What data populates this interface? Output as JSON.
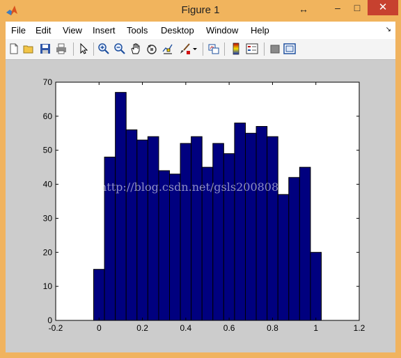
{
  "window": {
    "title": "Figure 1",
    "controls": {
      "resize": "↔",
      "minimize": "–",
      "maximize": "□",
      "close": "✕"
    }
  },
  "menu": {
    "items": [
      "File",
      "Edit",
      "View",
      "Insert",
      "Tools",
      "Desktop",
      "Window",
      "Help"
    ],
    "dock_arrow": "↘"
  },
  "toolbar": {
    "buttons": [
      "new-figure-icon",
      "open-file-icon",
      "save-icon",
      "print-icon",
      "edit-plot-arrow-icon",
      "zoom-in-icon",
      "zoom-out-icon",
      "pan-hand-icon",
      "rotate-3d-icon",
      "data-cursor-icon",
      "brush-icon",
      "brush-dropdown-icon",
      "link-plot-icon",
      "colorbar-icon",
      "legend-icon",
      "hide-plot-tools-icon",
      "show-plot-tools-icon"
    ]
  },
  "watermark": "http://blog.csdn.net/gsls200808",
  "colors": {
    "bar_fill": "#00007f",
    "bar_edge": "#000000",
    "figure_bg": "#cccccc",
    "axes_bg": "#ffffff",
    "title_bar": "#f1b45d",
    "close_button": "#c7412f"
  },
  "chart_data": {
    "type": "bar",
    "bin_width": 0.05,
    "x": [
      0.0,
      0.05,
      0.1,
      0.15,
      0.2,
      0.25,
      0.3,
      0.35,
      0.4,
      0.45,
      0.5,
      0.55,
      0.6,
      0.65,
      0.7,
      0.75,
      0.8,
      0.85,
      0.9,
      0.95,
      1.0
    ],
    "values": [
      15,
      48,
      67,
      56,
      53,
      54,
      44,
      43,
      52,
      54,
      45,
      52,
      49,
      58,
      55,
      57,
      54,
      37,
      42,
      45,
      20
    ],
    "xlim": [
      -0.2,
      1.2
    ],
    "ylim": [
      0,
      70
    ],
    "xticks": [
      "-0.2",
      "0",
      "0.2",
      "0.4",
      "0.6",
      "0.8",
      "1",
      "1.2"
    ],
    "yticks": [
      "0",
      "10",
      "20",
      "30",
      "40",
      "50",
      "60",
      "70"
    ],
    "grid": false,
    "title": "",
    "xlabel": "",
    "ylabel": ""
  }
}
